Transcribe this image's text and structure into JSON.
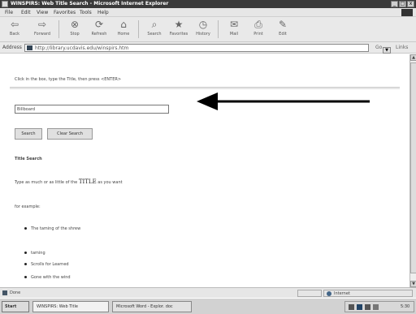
{
  "window": {
    "title": "WINSPIRS: Web Title Search - Microsoft Internet Explorer",
    "controls": [
      "_",
      "□",
      "x"
    ]
  },
  "menu": [
    "File",
    "Edit",
    "View",
    "Favorites",
    "Tools",
    "Help"
  ],
  "toolbar": {
    "buttons": [
      {
        "label": "Back",
        "icon": "back-arrow-icon",
        "glyph": "⇦"
      },
      {
        "label": "Forward",
        "icon": "forward-arrow-icon",
        "glyph": "⇨"
      },
      {
        "label": "Stop",
        "icon": "stop-icon",
        "glyph": "⊗"
      },
      {
        "label": "Refresh",
        "icon": "refresh-icon",
        "glyph": "⟳"
      },
      {
        "label": "Home",
        "icon": "home-icon",
        "glyph": "⌂"
      },
      {
        "label": "Search",
        "icon": "search-icon",
        "glyph": "⌕"
      },
      {
        "label": "Favorites",
        "icon": "favorites-icon",
        "glyph": "★"
      },
      {
        "label": "History",
        "icon": "history-icon",
        "glyph": "◷"
      },
      {
        "label": "Mail",
        "icon": "mail-icon",
        "glyph": "✉"
      },
      {
        "label": "Print",
        "icon": "print-icon",
        "glyph": "⎙"
      },
      {
        "label": "Edit",
        "icon": "edit-icon",
        "glyph": "✎"
      }
    ]
  },
  "address": {
    "label": "Address",
    "url": "http://library.ucdavis.edu/winspirs.htm",
    "go": "Go",
    "links": "Links"
  },
  "page": {
    "intro": "Click in the box, type the Title, then press <ENTER>",
    "search_value": "Billboard",
    "search_button": "Search",
    "clear_button": "Clear Search",
    "heading": "Title Search",
    "desc_before": "Type as much or as little of the ",
    "desc_title_word": "TITLE",
    "desc_after": " as you want",
    "example_label": "for example:",
    "bullets": [
      "The taming of the shrew",
      "taming",
      "Scrolls for Learned",
      "Gone with the wind"
    ]
  },
  "status": {
    "text": "Done",
    "zone": "Internet"
  },
  "taskbar": {
    "start": "Start",
    "tasks": [
      {
        "label": "WINSPIRS: Web Title"
      },
      {
        "label": "Microsoft Word - Explor. doc"
      }
    ],
    "clock": "5:30 PM"
  }
}
